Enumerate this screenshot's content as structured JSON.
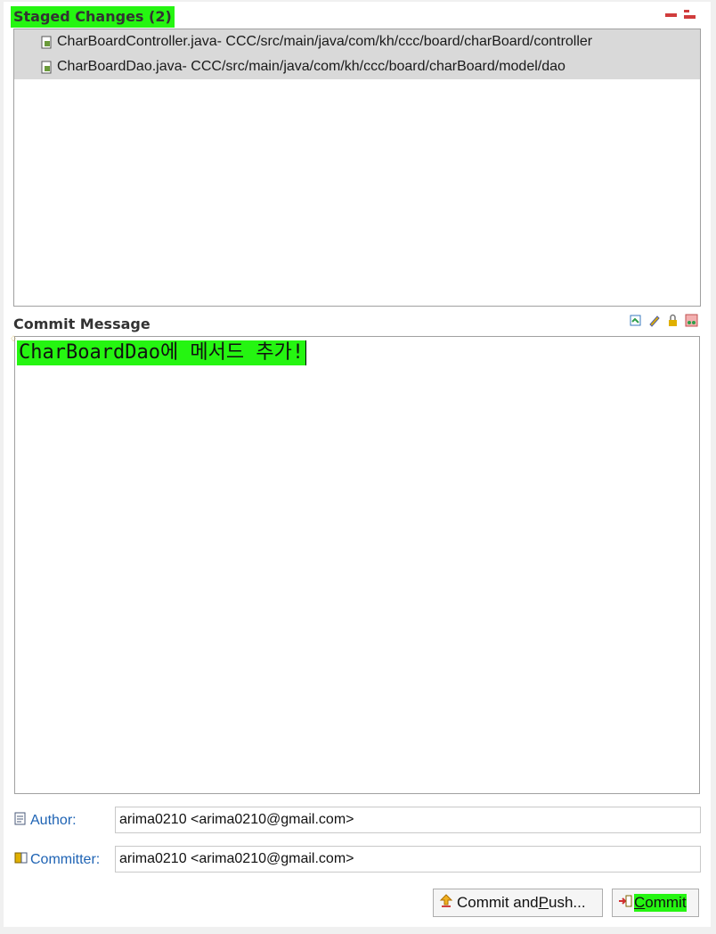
{
  "staged": {
    "title": "Staged Changes (2)",
    "files": [
      {
        "name": "CharBoardController.java",
        "path": " - CCC/src/main/java/com/kh/ccc/board/charBoard/controller"
      },
      {
        "name": "CharBoardDao.java",
        "path": " - CCC/src/main/java/com/kh/ccc/board/charBoard/model/dao"
      }
    ],
    "icons": [
      "collapse-all-icon",
      "expand-all-icon"
    ]
  },
  "commit_message": {
    "title": "Commit Message",
    "text": "CharBoardDao에 메서드 추가!",
    "icons": [
      "signed-off-icon",
      "amend-icon",
      "sign-icon",
      "change-id-icon"
    ]
  },
  "author": {
    "label": "Author:",
    "value": "arima0210 <arima0210@gmail.com>"
  },
  "committer": {
    "label": "Committer:",
    "value": "arima0210 <arima0210@gmail.com>"
  },
  "buttons": {
    "commit_and_push_prefix": "Commit and ",
    "commit_and_push_mnemonic": "P",
    "commit_and_push_suffix": "ush...",
    "commit_mnemonic": "C",
    "commit_suffix": "ommit"
  },
  "colors": {
    "highlight": "#25f511",
    "link_blue": "#1e63b4",
    "selection": "#d9d9d9"
  }
}
